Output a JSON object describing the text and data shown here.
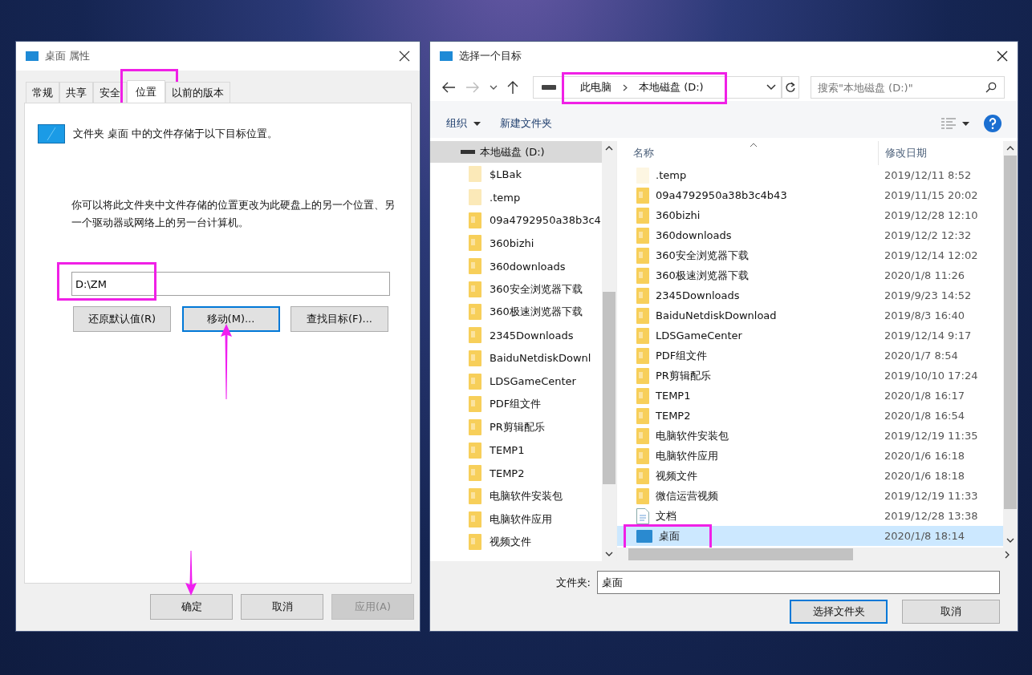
{
  "properties_window": {
    "title": "桌面 属性",
    "tabs": [
      {
        "label": "常规",
        "selected": false,
        "highlighted": false
      },
      {
        "label": "共享",
        "selected": false,
        "highlighted": false
      },
      {
        "label": "安全",
        "selected": false,
        "highlighted": false
      },
      {
        "label": "位置",
        "selected": true,
        "highlighted": true
      },
      {
        "label": "以前的版本",
        "selected": false,
        "highlighted": false
      }
    ],
    "location_text": "文件夹 桌面 中的文件存储于以下目标位置。",
    "description": "你可以将此文件夹中文件存储的位置更改为此硬盘上的另一个位置、另一个驱动器或网络上的另一台计算机。",
    "target_path": {
      "value": "D:\\ZM",
      "highlighted": true
    },
    "path_buttons": [
      {
        "label": "还原默认值(R)",
        "focused": false,
        "pointed_at": false
      },
      {
        "label": "移动(M)...",
        "focused": true,
        "pointed_at": true
      },
      {
        "label": "查找目标(F)...",
        "focused": false,
        "pointed_at": false
      }
    ],
    "buttons": [
      {
        "label": "确定",
        "disabled": false,
        "pointed_at": true
      },
      {
        "label": "取消",
        "disabled": false,
        "pointed_at": false
      },
      {
        "label": "应用(A)",
        "disabled": true,
        "pointed_at": false
      }
    ]
  },
  "select_dialog": {
    "title": "选择一个目标",
    "address": {
      "breadcrumbs": [
        "此电脑",
        "本地磁盘 (D:)"
      ],
      "highlighted": true
    },
    "search": {
      "placeholder": "搜索\"本地磁盘 (D:)\""
    },
    "toolbar": [
      {
        "label": "组织",
        "kind": "menu"
      },
      {
        "label": "新建文件夹",
        "kind": "button"
      }
    ],
    "tree": {
      "label": "本地磁盘 (D:)",
      "selected": true,
      "expanded": true,
      "children": [
        {
          "label": "$LBak",
          "hidden": true
        },
        {
          "label": ".temp",
          "hidden": true
        },
        {
          "label": "09a4792950a38b3c4",
          "hidden": false
        },
        {
          "label": "360bizhi",
          "hidden": false
        },
        {
          "label": "360downloads",
          "hidden": false
        },
        {
          "label": "360安全浏览器下载",
          "hidden": false
        },
        {
          "label": "360极速浏览器下载",
          "hidden": false
        },
        {
          "label": "2345Downloads",
          "hidden": false
        },
        {
          "label": "BaiduNetdiskDownl",
          "hidden": false
        },
        {
          "label": "LDSGameCenter",
          "hidden": false
        },
        {
          "label": "PDF组文件",
          "hidden": false
        },
        {
          "label": "PR剪辑配乐",
          "hidden": false
        },
        {
          "label": "TEMP1",
          "hidden": false
        },
        {
          "label": "TEMP2",
          "hidden": false
        },
        {
          "label": "电脑软件安装包",
          "hidden": false
        },
        {
          "label": "电脑软件应用",
          "hidden": false
        },
        {
          "label": "视频文件",
          "hidden": false
        }
      ]
    },
    "columns": [
      "名称",
      "修改日期"
    ],
    "rows": [
      {
        "name": ".temp",
        "date": "2019/12/11 8:52",
        "kind": "folder",
        "hidden": true,
        "selected": false,
        "highlighted": false
      },
      {
        "name": "09a4792950a38b3c4b43",
        "date": "2019/11/15 20:02",
        "kind": "folder",
        "hidden": false,
        "selected": false,
        "highlighted": false
      },
      {
        "name": "360bizhi",
        "date": "2019/12/28 12:10",
        "kind": "folder",
        "hidden": false,
        "selected": false,
        "highlighted": false
      },
      {
        "name": "360downloads",
        "date": "2019/12/2 12:32",
        "kind": "folder",
        "hidden": false,
        "selected": false,
        "highlighted": false
      },
      {
        "name": "360安全浏览器下载",
        "date": "2019/12/14 12:02",
        "kind": "folder",
        "hidden": false,
        "selected": false,
        "highlighted": false
      },
      {
        "name": "360极速浏览器下载",
        "date": "2020/1/8 11:26",
        "kind": "folder",
        "hidden": false,
        "selected": false,
        "highlighted": false
      },
      {
        "name": "2345Downloads",
        "date": "2019/9/23 14:52",
        "kind": "folder",
        "hidden": false,
        "selected": false,
        "highlighted": false
      },
      {
        "name": "BaiduNetdiskDownload",
        "date": "2019/8/3 16:40",
        "kind": "folder",
        "hidden": false,
        "selected": false,
        "highlighted": false
      },
      {
        "name": "LDSGameCenter",
        "date": "2019/12/14 9:17",
        "kind": "folder",
        "hidden": false,
        "selected": false,
        "highlighted": false
      },
      {
        "name": "PDF组文件",
        "date": "2020/1/7 8:54",
        "kind": "folder",
        "hidden": false,
        "selected": false,
        "highlighted": false
      },
      {
        "name": "PR剪辑配乐",
        "date": "2019/10/10 17:24",
        "kind": "folder",
        "hidden": false,
        "selected": false,
        "highlighted": false
      },
      {
        "name": "TEMP1",
        "date": "2020/1/8 16:17",
        "kind": "folder",
        "hidden": false,
        "selected": false,
        "highlighted": false
      },
      {
        "name": "TEMP2",
        "date": "2020/1/8 16:54",
        "kind": "folder",
        "hidden": false,
        "selected": false,
        "highlighted": false
      },
      {
        "name": "电脑软件安装包",
        "date": "2019/12/19 11:35",
        "kind": "folder",
        "hidden": false,
        "selected": false,
        "highlighted": false
      },
      {
        "name": "电脑软件应用",
        "date": "2020/1/6 16:18",
        "kind": "folder",
        "hidden": false,
        "selected": false,
        "highlighted": false
      },
      {
        "name": "视频文件",
        "date": "2020/1/6 18:18",
        "kind": "folder",
        "hidden": false,
        "selected": false,
        "highlighted": false
      },
      {
        "name": "微信运营视频",
        "date": "2019/12/19 11:33",
        "kind": "folder",
        "hidden": false,
        "selected": false,
        "highlighted": false
      },
      {
        "name": "文档",
        "date": "2019/12/28 13:38",
        "kind": "document",
        "hidden": false,
        "selected": false,
        "highlighted": false
      },
      {
        "name": "桌面",
        "date": "2020/1/8 18:14",
        "kind": "desktop",
        "hidden": false,
        "selected": true,
        "highlighted": true
      }
    ],
    "folder_label": "文件夹:",
    "folder_value": "桌面",
    "buttons": [
      {
        "label": "选择文件夹",
        "focused": true
      },
      {
        "label": "取消",
        "focused": false
      }
    ]
  }
}
